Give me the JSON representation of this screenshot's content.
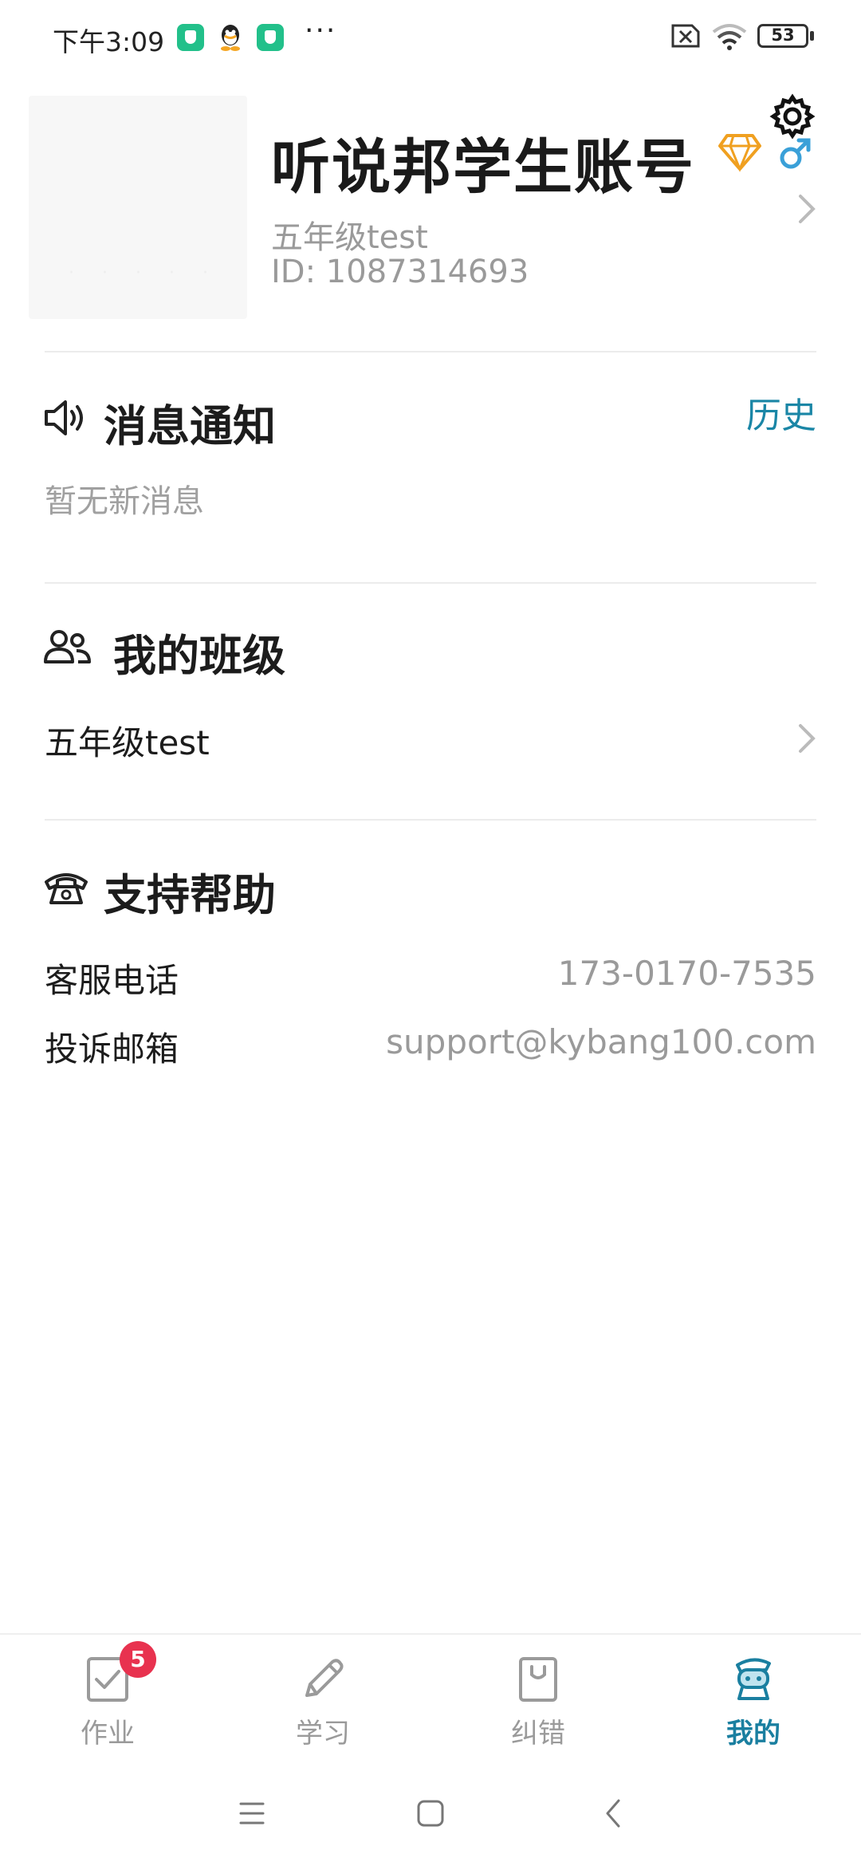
{
  "status_bar": {
    "time": "下午3:09",
    "more_glyph": "···",
    "battery": "53",
    "icons": [
      "shield-app-icon",
      "qq-icon",
      "shield-app-icon",
      "sim-off-icon",
      "wifi-icon",
      "battery-icon"
    ]
  },
  "profile": {
    "name": "听说邦学生账号",
    "class_name": "五年级test",
    "id_text": "ID: 1087314693",
    "icons": [
      "gem-icon",
      "male-icon",
      "gear-icon",
      "chevron-right-icon"
    ],
    "colors": {
      "gem": "#f0a020",
      "gender": "#3aa0d8"
    }
  },
  "notifications": {
    "title": "消息通知",
    "history_label": "历史",
    "empty_text": "暂无新消息"
  },
  "my_class": {
    "title": "我的班级",
    "class_name": "五年级test"
  },
  "support": {
    "title": "支持帮助",
    "rows": [
      {
        "label": "客服电话",
        "value": "173-0170-7535"
      },
      {
        "label": "投诉邮箱",
        "value": "support@kybang100.com"
      }
    ]
  },
  "bottom_nav": {
    "items": [
      {
        "label": "作业",
        "icon": "homework-icon",
        "badge": "5",
        "active": false
      },
      {
        "label": "学习",
        "icon": "pencil-icon",
        "active": false
      },
      {
        "label": "纠错",
        "icon": "bag-icon",
        "active": false
      },
      {
        "label": "我的",
        "icon": "profile-robot-icon",
        "active": true
      }
    ],
    "colors": {
      "active": "#1a7fa0",
      "inactive": "#9a9a9a",
      "badge": "#e8324f"
    }
  },
  "system_nav": [
    "menu-icon",
    "home-icon",
    "back-icon"
  ]
}
